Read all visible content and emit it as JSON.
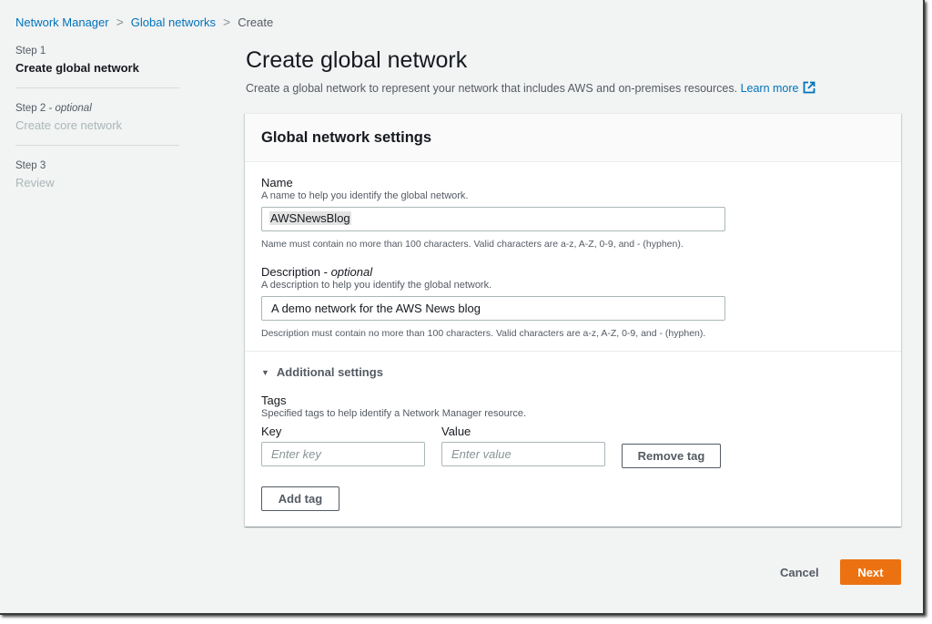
{
  "breadcrumb": {
    "items": [
      {
        "label": "Network Manager"
      },
      {
        "label": "Global networks"
      },
      {
        "label": "Create"
      }
    ],
    "separator": ">"
  },
  "steps": [
    {
      "number": "Step 1",
      "optional": "",
      "title": "Create global network",
      "active": true
    },
    {
      "number": "Step 2 - ",
      "optional": "optional",
      "title": "Create core network",
      "active": false
    },
    {
      "number": "Step 3",
      "optional": "",
      "title": "Review",
      "active": false
    }
  ],
  "page": {
    "title": "Create global network",
    "description": "Create a global network to represent your network that includes AWS and on-premises resources.",
    "learn_more": "Learn more",
    "learn_more_icon": "external-link-icon"
  },
  "card": {
    "title": "Global network settings",
    "name": {
      "label": "Name",
      "hint": "A name to help you identify the global network.",
      "value": "AWSNewsBlog",
      "constraint": "Name must contain no more than 100 characters. Valid characters are a-z, A-Z, 0-9, and - (hyphen)."
    },
    "description": {
      "label": "Description - ",
      "label_optional": "optional",
      "hint": "A description to help you identify the global network.",
      "value": "A demo network for the AWS News blog",
      "constraint": "Description must contain no more than 100 characters. Valid characters are a-z, A-Z, 0-9, and - (hyphen)."
    },
    "additional_settings": {
      "label": "Additional settings",
      "expanded": true,
      "icon": "caret-down-icon"
    },
    "tags": {
      "label": "Tags",
      "hint": "Specified tags to help identify a Network Manager resource.",
      "key_label": "Key",
      "value_label": "Value",
      "key_placeholder": "Enter key",
      "value_placeholder": "Enter value",
      "key_value": "",
      "value_value": "",
      "remove_label": "Remove tag",
      "add_label": "Add tag"
    }
  },
  "footer": {
    "cancel_label": "Cancel",
    "next_label": "Next"
  },
  "colors": {
    "primary": "#ec7211",
    "link": "#0073bb",
    "background": "#f2f3f3"
  }
}
